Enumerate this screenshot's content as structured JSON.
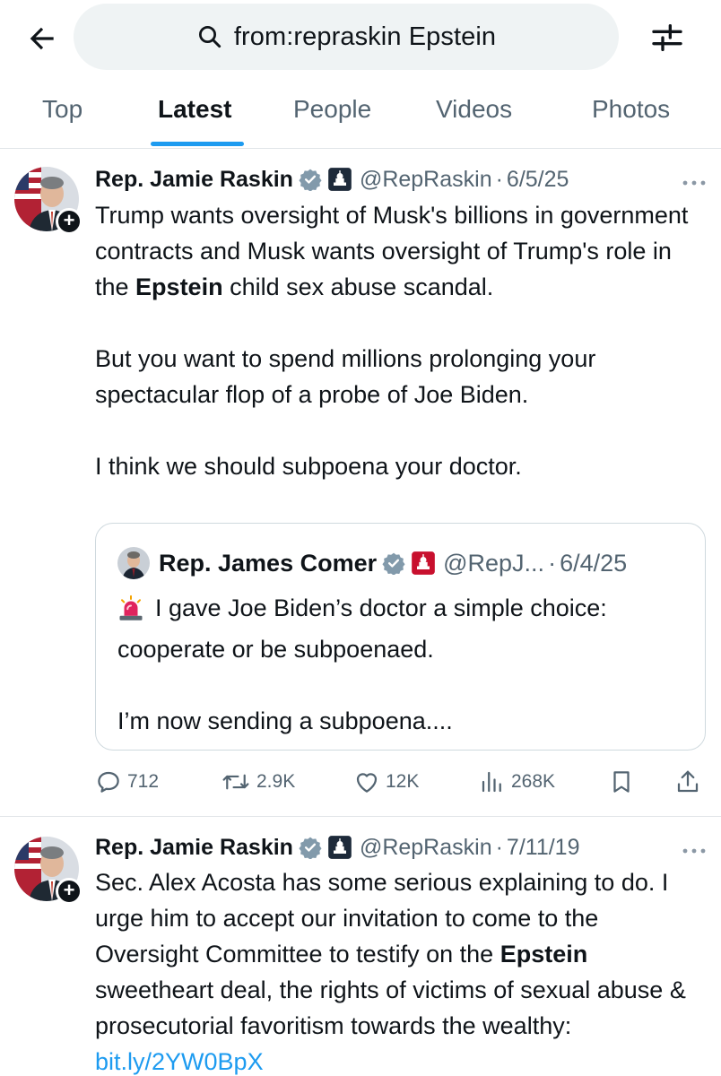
{
  "header": {
    "back_icon": "arrow-left-icon",
    "search_query": "from:repraskin Epstein",
    "search_icon": "search-icon",
    "filter_icon": "sliders-icon"
  },
  "tabs": [
    {
      "label": "Top",
      "active": false
    },
    {
      "label": "Latest",
      "active": true
    },
    {
      "label": "People",
      "active": false
    },
    {
      "label": "Videos",
      "active": false
    },
    {
      "label": "Photos",
      "active": false
    }
  ],
  "colors": {
    "accent": "#1d9bf0",
    "text": "#0f1419",
    "muted": "#536471",
    "verified_badge": "#829aab",
    "gov_badge_raskin": "#1d2a3a",
    "gov_badge_comer": "#c8102e"
  },
  "tweets": [
    {
      "author": "Rep. Jamie Raskin",
      "handle": "@RepRaskin",
      "separator": "·",
      "date": "6/5/25",
      "body": [
        {
          "text": "Trump wants oversight of Musk's billions in government contracts and Musk wants oversight of Trump's role in the ",
          "bold": "Epstein",
          "after": " child sex abuse scandal."
        },
        {
          "text": "But you want to spend millions prolonging your spectacular flop of a probe of Joe Biden."
        },
        {
          "text": "I think we should subpoena your doctor."
        }
      ],
      "quote": {
        "author": "Rep. James Comer",
        "handle": "@RepJ...",
        "separator": "·",
        "date": "6/4/25",
        "icon": "siren-icon",
        "body": [
          "I gave Joe Biden’s doctor a simple choice: cooperate or be subpoenaed.",
          "I’m now sending a subpoena...."
        ]
      },
      "stats": {
        "replies": "712",
        "reposts": "2.9K",
        "likes": "12K",
        "views": "268K"
      }
    },
    {
      "author": "Rep. Jamie Raskin",
      "handle": "@RepRaskin",
      "separator": "·",
      "date": "7/11/19",
      "body_before": "Sec. Alex Acosta has some serious explaining to do. I urge him to accept our invitation to come to the Oversight Committee to testify on the ",
      "body_bold": "Epstein",
      "body_after": " sweetheart deal, the rights of victims of sexual abuse & prosecutorial favoritism towards the wealthy: ",
      "link": "bit.ly/2YW0BpX"
    }
  ]
}
